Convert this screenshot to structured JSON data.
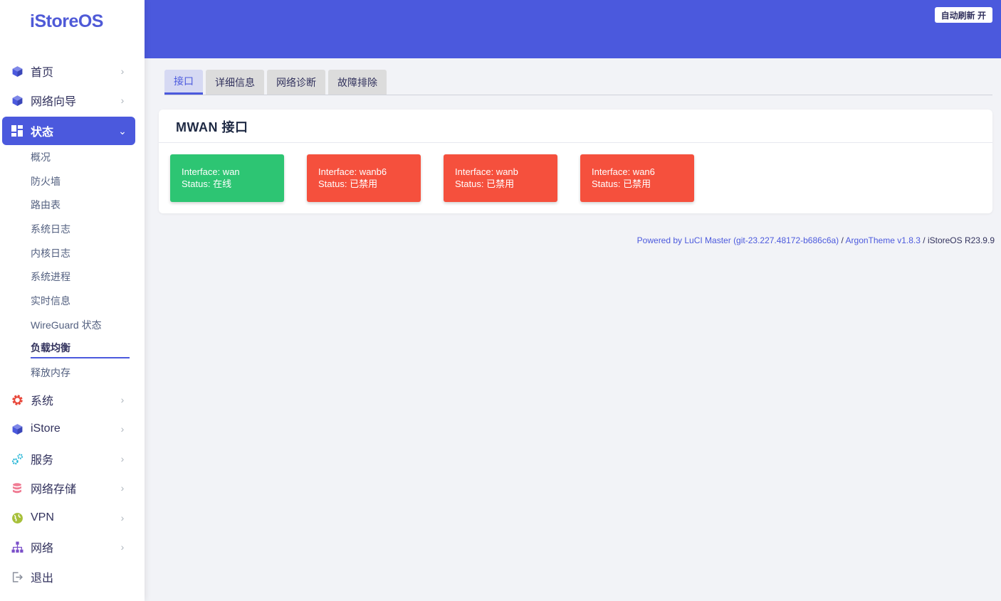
{
  "brand": {
    "logo": "iStoreOS"
  },
  "header": {
    "refresh_label": "自动刷新 开"
  },
  "colors": {
    "accent": "#4b59dd",
    "online": "#2dc573",
    "disabled": "#f5503d"
  },
  "sidebar": {
    "items": [
      {
        "label": "首页",
        "icon": "cube-icon"
      },
      {
        "label": "网络向导",
        "icon": "cube-icon"
      },
      {
        "label": "状态",
        "icon": "dashboard-icon",
        "active": true
      },
      {
        "label": "系统",
        "icon": "gear-icon"
      },
      {
        "label": "iStore",
        "icon": "cube-icon"
      },
      {
        "label": "服务",
        "icon": "gears-icon"
      },
      {
        "label": "网络存储",
        "icon": "database-icon"
      },
      {
        "label": "VPN",
        "icon": "globe-icon"
      },
      {
        "label": "网络",
        "icon": "network-icon"
      },
      {
        "label": "退出",
        "icon": "logout-icon"
      }
    ],
    "status_sub": [
      "概况",
      "防火墙",
      "路由表",
      "系统日志",
      "内核日志",
      "系统进程",
      "实时信息",
      "WireGuard 状态",
      "负载均衡",
      "释放内存"
    ]
  },
  "tabs": [
    "接口",
    "详细信息",
    "网络诊断",
    "故障排除"
  ],
  "card": {
    "title": "MWAN 接口",
    "interfaces": [
      {
        "line1": "Interface: wan",
        "line2": "Status: 在线",
        "state": "online"
      },
      {
        "line1": "Interface: wanb6",
        "line2": "Status: 已禁用",
        "state": "disabled"
      },
      {
        "line1": "Interface: wanb",
        "line2": "Status: 已禁用",
        "state": "disabled"
      },
      {
        "line1": "Interface: wan6",
        "line2": "Status: 已禁用",
        "state": "disabled"
      }
    ]
  },
  "footer": {
    "luci": "Powered by LuCI Master (git-23.227.48172-b686c6a)",
    "sep1": " / ",
    "theme": "ArgonTheme v1.8.3",
    "sep2": " / ",
    "os": "iStoreOS R23.9.9"
  }
}
